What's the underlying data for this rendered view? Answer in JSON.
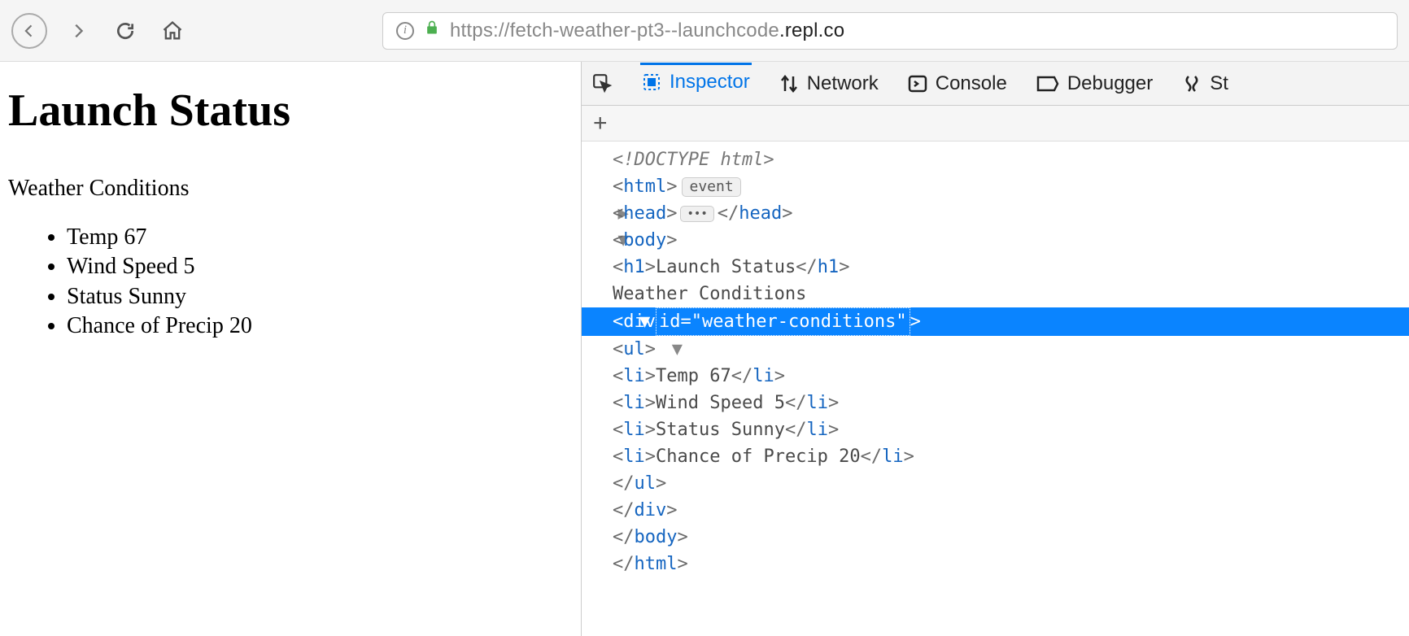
{
  "toolbar": {
    "url_secure_prefix": "https://fetch-weather-pt3--launchcode",
    "url_dark_suffix": ".repl.co"
  },
  "page": {
    "title": "Launch Status",
    "subhead": "Weather Conditions",
    "items": [
      "Temp 67",
      "Wind Speed 5",
      "Status Sunny",
      "Chance of Precip 20"
    ]
  },
  "devtools": {
    "tabs": {
      "inspector": "Inspector",
      "network": "Network",
      "console": "Console",
      "debugger": "Debugger",
      "last_partial": "St"
    },
    "event_pill": "event",
    "dom": {
      "doctype": "<!DOCTYPE html>",
      "html_open": "html",
      "head_tag": "head",
      "body_tag": "body",
      "h1_tag": "h1",
      "h1_text": "Launch Status",
      "text_weather": "Weather Conditions",
      "div_tag": "div",
      "div_attr_name": "id",
      "div_attr_val": "weather-conditions",
      "ul_tag": "ul",
      "li_tag": "li",
      "li_texts": [
        "Temp 67",
        "Wind Speed 5",
        "Status Sunny",
        "Chance of Precip 20"
      ]
    }
  }
}
